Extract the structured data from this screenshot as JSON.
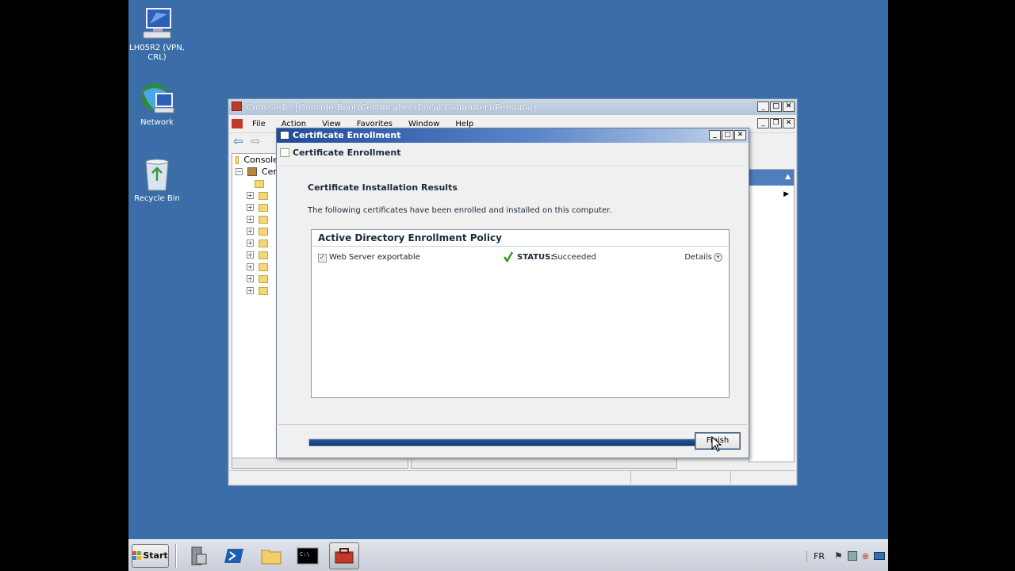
{
  "desktop": {
    "icons": [
      {
        "label": "LH05R2 (VPN, CRL)",
        "icon": "computer-icon"
      },
      {
        "label": "Network",
        "icon": "network-globe-icon"
      },
      {
        "label": "Recycle Bin",
        "icon": "recycle-bin-icon"
      }
    ]
  },
  "mmc": {
    "title": "Console1 - [Console Root\\Certificates (Local Computer)\\Personal]",
    "menu": [
      "File",
      "Action",
      "View",
      "Favorites",
      "Window",
      "Help"
    ],
    "tree": {
      "root": "Console",
      "child": "Cer"
    }
  },
  "dialog": {
    "title": "Certificate Enrollment",
    "header": "Certificate Enrollment",
    "heading": "Certificate Installation Results",
    "description": "The following certificates have been enrolled and installed on this computer.",
    "policy_title": "Active Directory Enrollment Policy",
    "item": {
      "label": "Web Server exportable",
      "checked": true,
      "status_key": "STATUS:",
      "status_value": "Succeeded",
      "details_label": "Details"
    },
    "progress_fraction": 1.0,
    "finish_label": "Finish"
  },
  "taskbar": {
    "start_label": "Start",
    "language": "FR",
    "buttons": [
      {
        "icon": "server-manager-icon"
      },
      {
        "icon": "powershell-icon"
      },
      {
        "icon": "explorer-folder-icon"
      },
      {
        "icon": "command-prompt-icon"
      },
      {
        "icon": "mmc-toolbox-icon",
        "active": true
      }
    ]
  },
  "colors": {
    "desktop": "#3b6ea8",
    "dialog_title": "#1e4c9a",
    "progress": "#10346e",
    "success": "#3a9a2a"
  }
}
